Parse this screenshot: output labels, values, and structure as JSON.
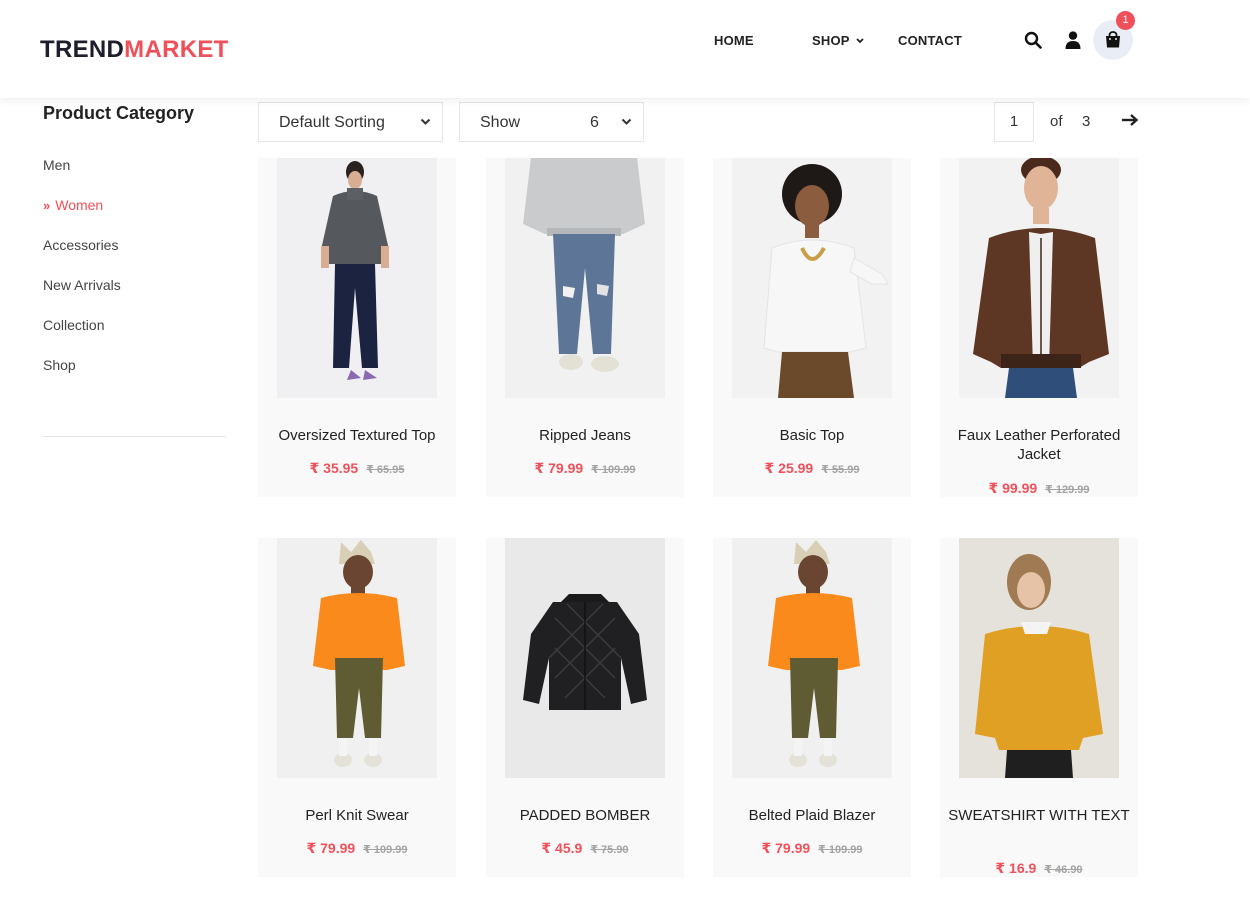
{
  "header": {
    "logo_part1": "TREND",
    "logo_part2": "MARKET",
    "nav": [
      {
        "label": "HOME"
      },
      {
        "label": "SHOP"
      },
      {
        "label": "CONTACT"
      }
    ],
    "icons": [
      "search-icon",
      "user-icon",
      "shopping-bag-icon"
    ],
    "cart_count": "1"
  },
  "sidebar": {
    "title": "Product Category",
    "items": [
      {
        "label": "Men"
      },
      {
        "label": "Women",
        "active": true
      },
      {
        "label": "Accessories"
      },
      {
        "label": "New Arrivals"
      },
      {
        "label": "Collection"
      },
      {
        "label": "Shop"
      }
    ]
  },
  "toolbar": {
    "sort_label": "Default Sorting",
    "show_label": "Show",
    "show_value": "6",
    "page_current": "1",
    "page_of": "of",
    "page_total": "3"
  },
  "products": [
    {
      "name": "Oversized Textured Top",
      "price": "₹ 35.95",
      "old_price": "₹ 65.95"
    },
    {
      "name": "Ripped Jeans",
      "price": "₹ 79.99",
      "old_price": "₹ 109.99"
    },
    {
      "name": "Basic Top",
      "price": "₹ 25.99",
      "old_price": "₹ 55.99"
    },
    {
      "name": "Faux Leather Perforated Jacket",
      "price": "₹ 99.99",
      "old_price": "₹ 129.99"
    },
    {
      "name": "Perl Knit Swear",
      "price": "₹ 79.99",
      "old_price": "₹ 109.99"
    },
    {
      "name": "PADDED BOMBER",
      "price": "₹ 45.9",
      "old_price": "₹ 75.90"
    },
    {
      "name": "Belted Plaid Blazer",
      "price": "₹ 79.99",
      "old_price": "₹ 109.99"
    },
    {
      "name": "SWEATSHIRT WITH TEXT",
      "price": "₹ 16.9",
      "old_price": "₹ 46.90"
    }
  ],
  "colors": {
    "accent": "#f0505a",
    "dark": "#1d1d2b",
    "card_bg": "#f9f9f9",
    "cart_bg": "#e9edf6"
  }
}
